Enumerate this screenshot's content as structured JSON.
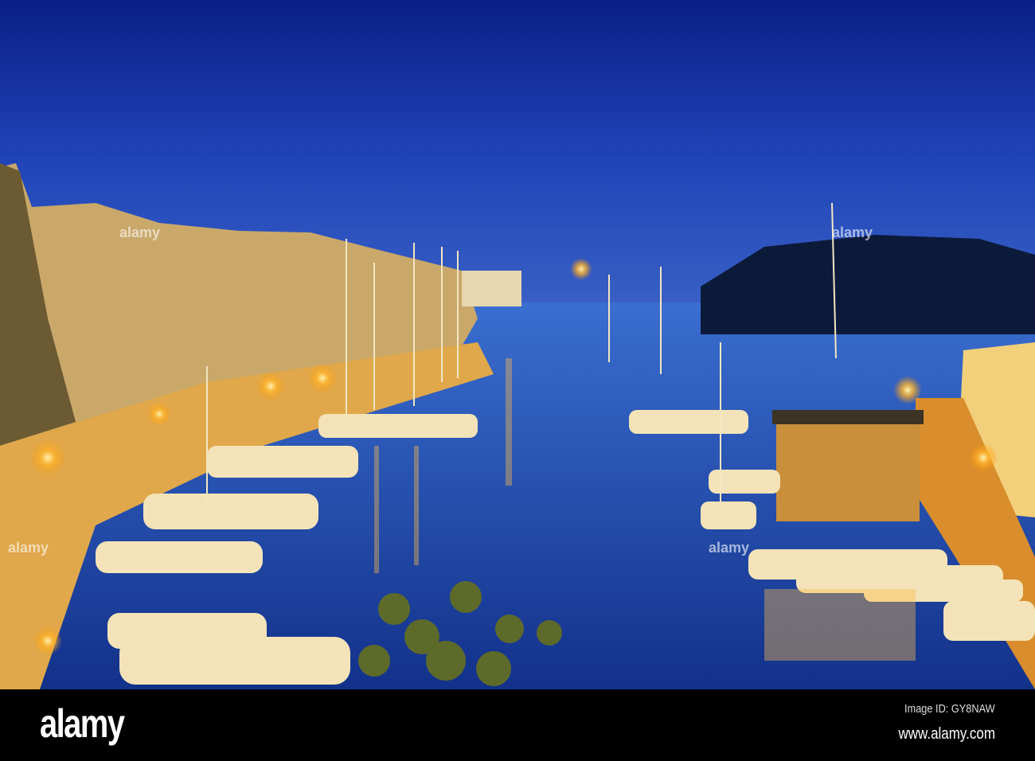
{
  "photo": {
    "colors": {
      "sky_top": "#0a1f8a",
      "sky_horizon": "#3a5fc8",
      "water": "#1a3c9a",
      "light": "#ffb52e"
    }
  },
  "watermark": {
    "logo": "alamy",
    "center_text": "alamy"
  },
  "footer": {
    "logo": "alamy",
    "image_id": "Image ID: GY8NAW",
    "url": "www.alamy.com"
  }
}
